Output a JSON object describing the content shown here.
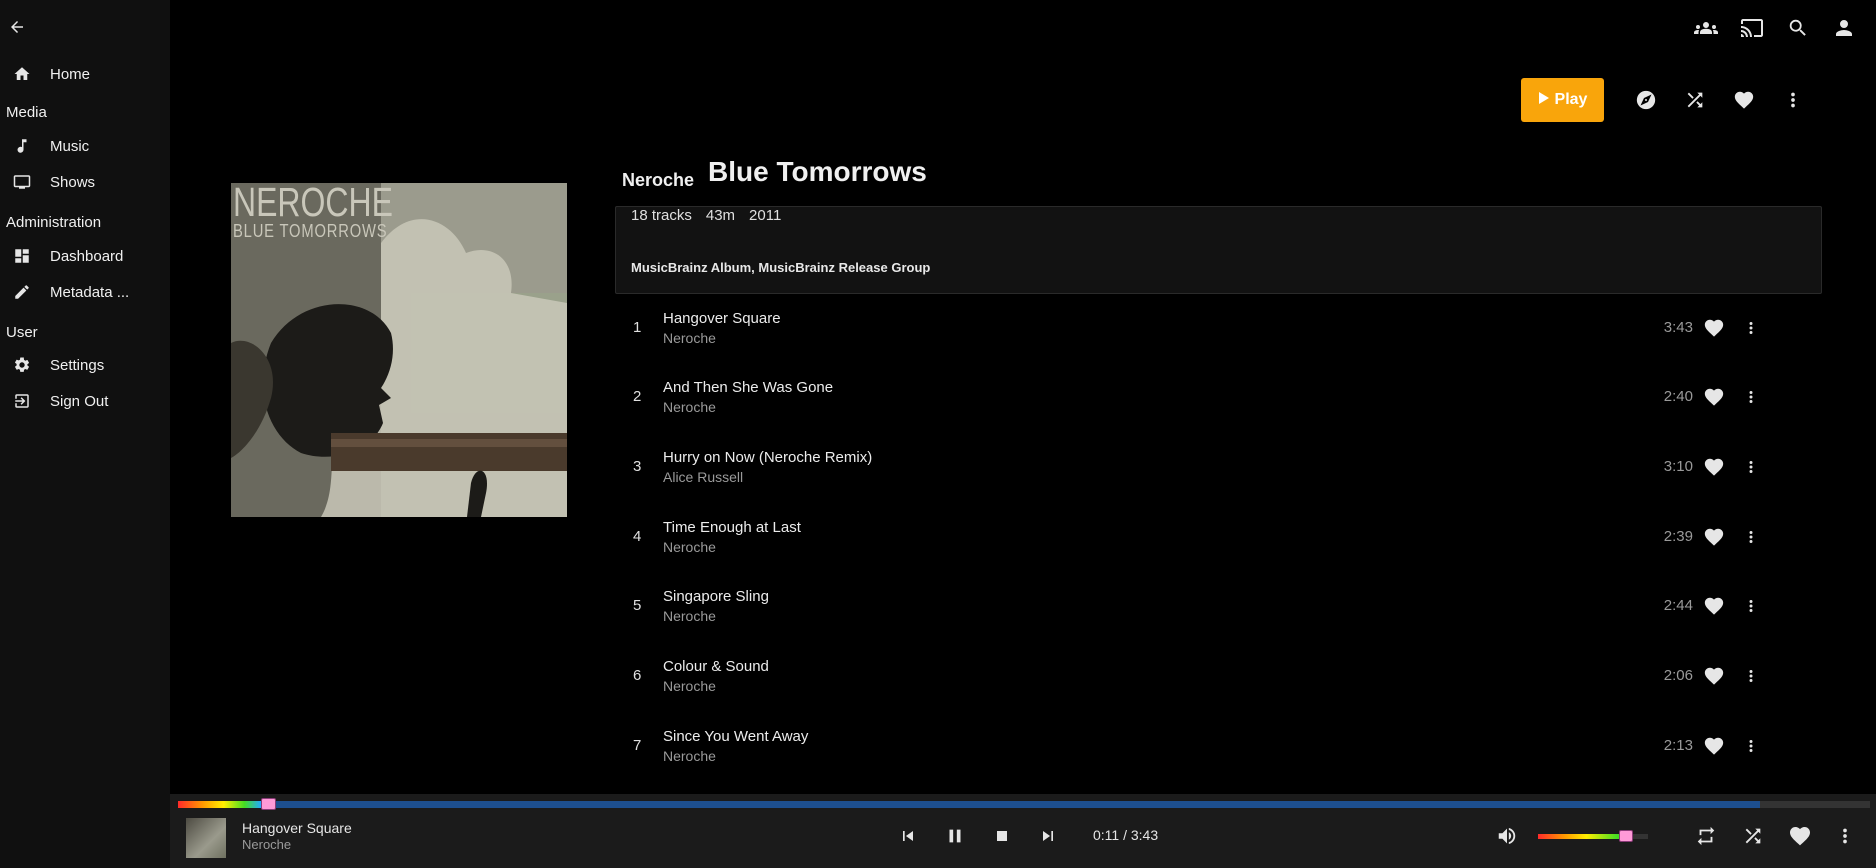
{
  "sidebar": {
    "home": "Home",
    "media_header": "Media",
    "music": "Music",
    "shows": "Shows",
    "admin_header": "Administration",
    "dashboard": "Dashboard",
    "metadata": "Metadata ...",
    "user_header": "User",
    "settings": "Settings",
    "signout": "Sign Out"
  },
  "actions": {
    "play_label": "Play",
    "play_color": "#f9a50b"
  },
  "album": {
    "artist": "Neroche",
    "title": "Blue Tomorrows",
    "art_artist_text": "NEROCHE",
    "art_title_text": "BLUE TOMORROWS",
    "track_count": "18 tracks",
    "runtime": "43m",
    "year": "2011",
    "links_1": "MusicBrainz Album",
    "links_sep": ", ",
    "links_2": "MusicBrainz Release Group"
  },
  "tracks": [
    {
      "num": "1",
      "name": "Hangover Square",
      "artist": "Neroche",
      "duration": "3:43"
    },
    {
      "num": "2",
      "name": "And Then She Was Gone",
      "artist": "Neroche",
      "duration": "2:40"
    },
    {
      "num": "3",
      "name": "Hurry on Now (Neroche Remix)",
      "artist": "Alice Russell",
      "duration": "3:10"
    },
    {
      "num": "4",
      "name": "Time Enough at Last",
      "artist": "Neroche",
      "duration": "2:39"
    },
    {
      "num": "5",
      "name": "Singapore Sling",
      "artist": "Neroche",
      "duration": "2:44"
    },
    {
      "num": "6",
      "name": "Colour & Sound",
      "artist": "Neroche",
      "duration": "2:06"
    },
    {
      "num": "7",
      "name": "Since You Went Away",
      "artist": "Neroche",
      "duration": "2:13"
    }
  ],
  "player": {
    "title": "Hangover Square",
    "artist": "Neroche",
    "time": "0:11 / 3:43",
    "played_fraction": 0.049,
    "buffered_fraction": 0.935,
    "volume_fraction": 0.8
  }
}
